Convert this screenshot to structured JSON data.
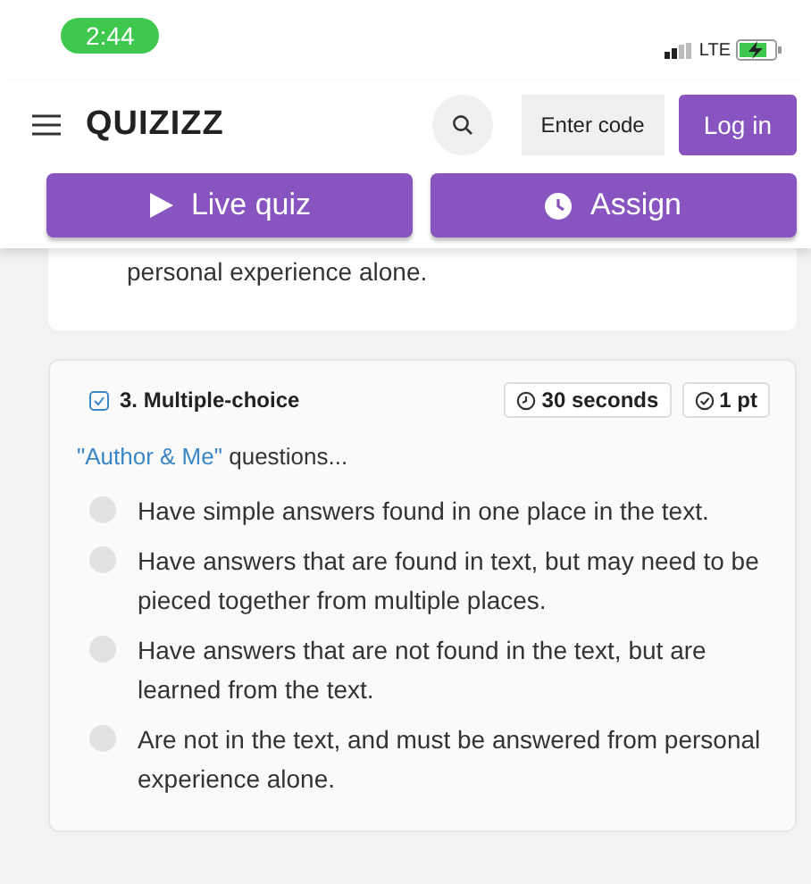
{
  "status_bar": {
    "time": "2:44",
    "network": "LTE"
  },
  "header": {
    "logo": "QUIZIZZ",
    "enter_code": "Enter code",
    "login": "Log in"
  },
  "actions": [
    {
      "kind": "play",
      "label": "Live quiz"
    },
    {
      "kind": "clock",
      "label": "Assign"
    }
  ],
  "previous_question": {
    "tail": "personal experience alone."
  },
  "question": {
    "number": "3. Multiple-choice",
    "time": "30 seconds",
    "points": "1 pt",
    "prompt_highlight": "\"Author & Me\"",
    "prompt": " questions...",
    "options": [
      {
        "text": "Have simple answers found in one place in the text.",
        "selected": false
      },
      {
        "text": "Have answers that are found in text, but may need to be pieced together from multiple places.",
        "selected": false
      },
      {
        "text": "Have answers that are not found in the text, but are learned from the text.",
        "selected": false
      },
      {
        "text": "Are not in the text, and must be answered from personal experience alone.",
        "selected": false
      }
    ]
  }
}
